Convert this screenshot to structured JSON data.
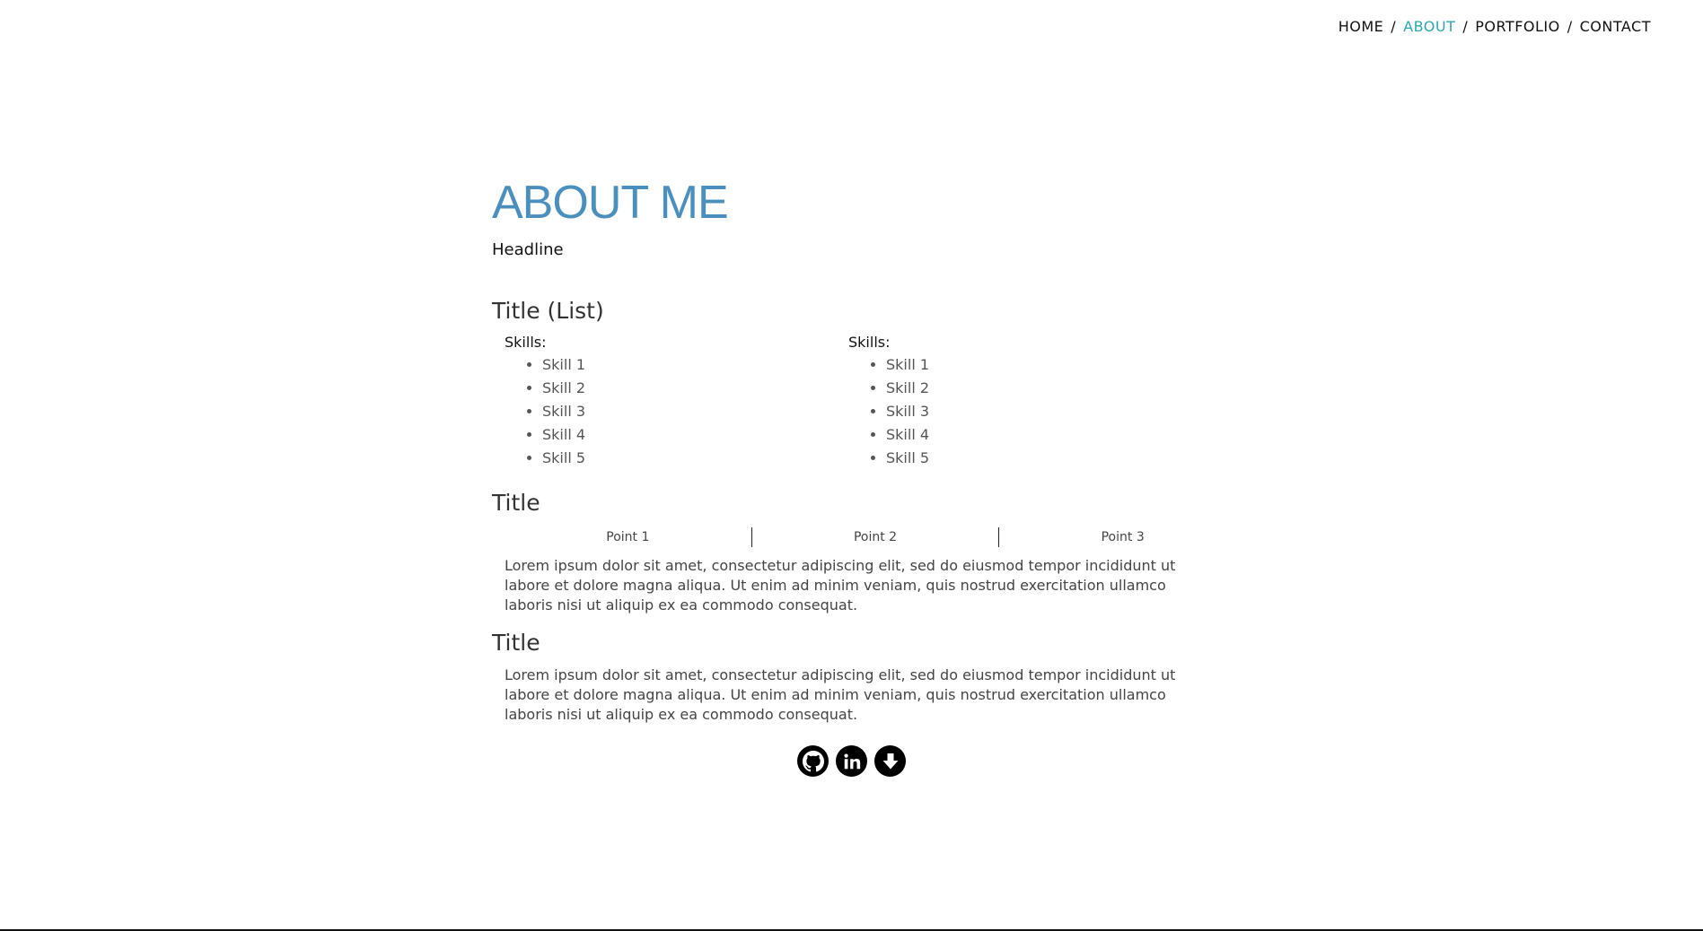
{
  "nav": {
    "items": [
      {
        "label": "HOME",
        "active": false
      },
      {
        "label": "ABOUT",
        "active": true
      },
      {
        "label": "PORTFOLIO",
        "active": false
      },
      {
        "label": "CONTACT",
        "active": false
      }
    ],
    "separator": "/",
    "active_color": "#2fa7b1"
  },
  "about": {
    "title": "ABOUT ME",
    "headline": "Headline",
    "title_color": "#4a8fbd"
  },
  "list_section": {
    "title": "Title (List)",
    "columns": [
      {
        "label": "Skills:",
        "items": [
          "Skill 1",
          "Skill 2",
          "Skill 3",
          "Skill 4",
          "Skill 5"
        ]
      },
      {
        "label": "Skills:",
        "items": [
          "Skill 1",
          "Skill 2",
          "Skill 3",
          "Skill 4",
          "Skill 5"
        ]
      }
    ]
  },
  "points_section": {
    "title": "Title",
    "points": [
      "Point 1",
      "Point 2",
      "Point 3"
    ],
    "text": "Lorem ipsum dolor sit amet, consectetur adipiscing elit, sed do eiusmod tempor incididunt ut labore et dolore magna aliqua. Ut enim ad minim veniam, quis nostrud exercitation ullamco laboris nisi ut aliquip ex ea commodo consequat."
  },
  "text_section": {
    "title": "Title",
    "text": "Lorem ipsum dolor sit amet, consectetur adipiscing elit, sed do eiusmod tempor incididunt ut labore et dolore magna aliqua. Ut enim ad minim veniam, quis nostrud exercitation ullamco laboris nisi ut aliquip ex ea commodo consequat."
  },
  "social": {
    "icons": [
      "github-icon",
      "linkedin-icon",
      "download-icon"
    ]
  }
}
